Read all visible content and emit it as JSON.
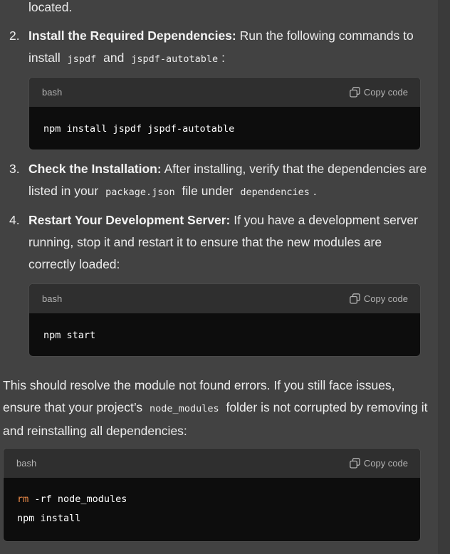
{
  "intro_tail": "located.",
  "steps": [
    {
      "number": "2.",
      "title": "Install the Required Dependencies:",
      "text_a": " Run the following commands to install ",
      "code_a": "jspdf",
      "text_b": " and ",
      "code_b": "jspdf-autotable",
      "text_c": ":"
    },
    {
      "number": "3.",
      "title": "Check the Installation:",
      "text_a": " After installing, verify that the dependencies are listed in your ",
      "code_a": "package.json",
      "text_b": " file under ",
      "code_b": "dependencies",
      "text_c": "."
    },
    {
      "number": "4.",
      "title": "Restart Your Development Server:",
      "text_a": " If you have a development server running, stop it and restart it to ensure that the new modules are correctly loaded:"
    }
  ],
  "code_blocks": [
    {
      "lang": "bash",
      "copy_label": "Copy code",
      "lines": [
        "npm install jspdf jspdf-autotable"
      ]
    },
    {
      "lang": "bash",
      "copy_label": "Copy code",
      "lines": [
        "npm start"
      ]
    },
    {
      "lang": "bash",
      "copy_label": "Copy code",
      "line1_cmd": "rm",
      "line1_rest": " -rf node_modules",
      "line2": "npm install"
    }
  ],
  "closing": {
    "text_a": "This should resolve the module not found errors. If you still face issues, ensure that your project’s ",
    "code": "node_modules",
    "text_b": " folder is not corrupted by removing it and reinstalling all dependencies:"
  },
  "icons": {
    "copy": "copy-icon"
  },
  "colors": {
    "background": "#424242",
    "code_bg": "#0d0d0d",
    "code_header": "#2f2f2f",
    "keyword": "#f08d49"
  }
}
